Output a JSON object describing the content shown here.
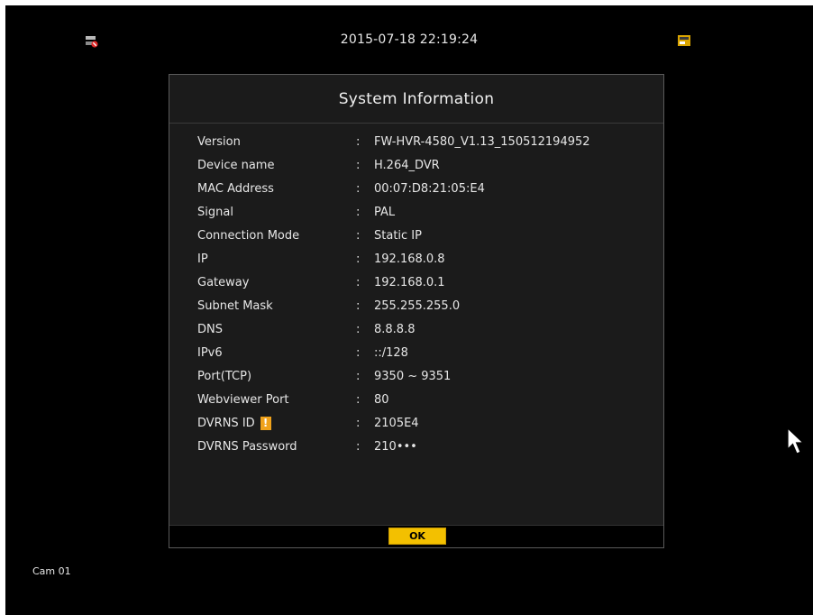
{
  "top_bar": {
    "datetime": "2015-07-18 22:19:24",
    "left_icon": "network-disconnected-icon",
    "right_icon": "storage-status-icon"
  },
  "dialog": {
    "title": "System Information",
    "rows": [
      {
        "label": "Version",
        "value": "FW-HVR-4580_V1.13_150512194952"
      },
      {
        "label": "Device name",
        "value": "H.264_DVR"
      },
      {
        "label": "MAC Address",
        "value": "00:07:D8:21:05:E4"
      },
      {
        "label": "Signal",
        "value": "PAL"
      },
      {
        "label": "Connection Mode",
        "value": "Static IP"
      },
      {
        "label": "IP",
        "value": "192.168.0.8"
      },
      {
        "label": "Gateway",
        "value": "192.168.0.1"
      },
      {
        "label": "Subnet Mask",
        "value": "255.255.255.0"
      },
      {
        "label": "DNS",
        "value": "8.8.8.8"
      },
      {
        "label": "IPv6",
        "value": "::/128"
      },
      {
        "label": "Port(TCP)",
        "value": "9350 ~ 9351"
      },
      {
        "label": "Webviewer Port",
        "value": "80"
      },
      {
        "label": "DVRNS ID",
        "value": "2105E4",
        "warning": "!"
      },
      {
        "label": "DVRNS Password",
        "value": "210•••"
      }
    ],
    "separator": ":",
    "ok_label": "OK"
  },
  "camera": {
    "label": "Cam 01"
  },
  "colors": {
    "background": "#000000",
    "dialog_bg": "#1b1b1b",
    "ok_button": "#f3c000",
    "warning": "#f0a21b"
  }
}
